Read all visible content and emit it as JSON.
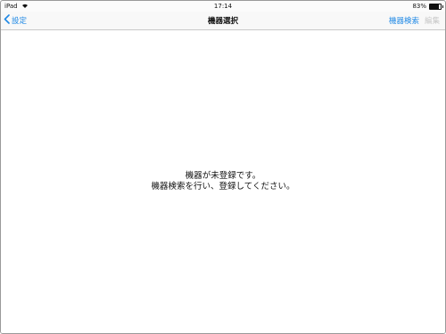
{
  "status_bar": {
    "device": "iPad",
    "time": "17:14",
    "battery_percent": "83%",
    "battery_level": 0.83,
    "wifi_icon": "wifi-icon"
  },
  "nav": {
    "back_label": "設定",
    "title": "機器選択",
    "search_label": "機器検索",
    "edit_label": "編集"
  },
  "message": {
    "line1": "機器が未登録です。",
    "line2": "機器検索を行い、登録してください。"
  },
  "colors": {
    "accent": "#1e88e5",
    "disabled": "#c7c7c7"
  }
}
